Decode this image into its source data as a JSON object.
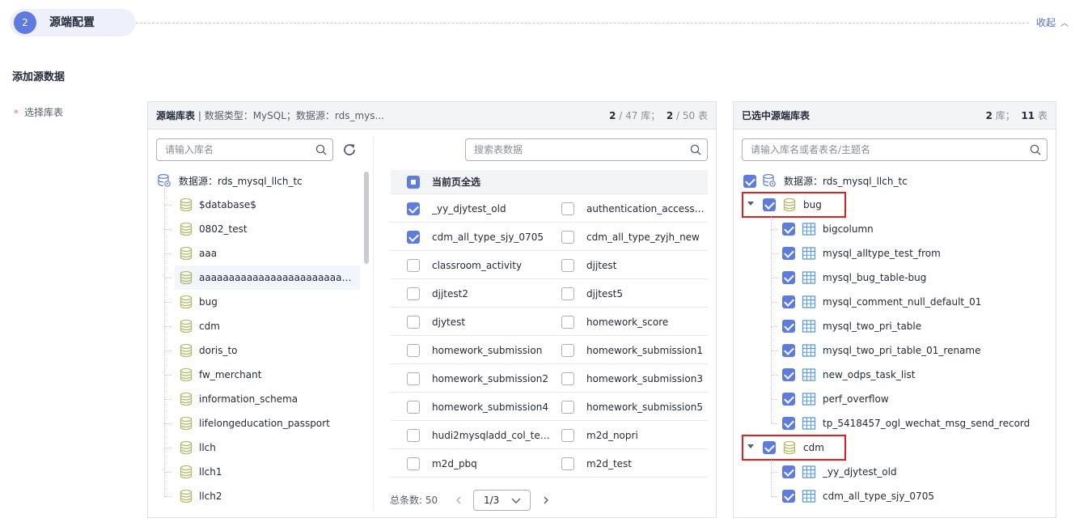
{
  "step": {
    "number": "2",
    "title": "源端配置",
    "collapse_label": "收起"
  },
  "section_title": "添加源数据",
  "field": {
    "required_mark": "*",
    "label": "选择库表"
  },
  "source_panel": {
    "title_bold": "源端库表",
    "title_rest": " | 数据类型：MySQL；数据源：rds_mys...",
    "count": {
      "db_selected": "2",
      "db_total": "/ 47 库；",
      "tbl_selected": "2",
      "tbl_total": "/ 50 表"
    },
    "db_search_placeholder": "请输入库名",
    "table_search_placeholder": "搜索表数据",
    "datasource_label": "数据源：rds_mysql_llch_tc",
    "databases": [
      "$database$",
      "0802_test",
      "aaa",
      "aaaaaaaaaaaaaaaaaaaaaaaaaaaaaaaaaa...",
      "bug",
      "cdm",
      "doris_to",
      "fw_merchant",
      "information_schema",
      "lifelongeducation_passport",
      "llch",
      "llch1",
      "llch2"
    ],
    "select_all_label": "当前页全选",
    "tables": [
      {
        "name": "_yy_djytest_old",
        "checked": true
      },
      {
        "name": "authentication_access_...",
        "checked": false
      },
      {
        "name": "cdm_all_type_sjy_0705",
        "checked": true
      },
      {
        "name": "cdm_all_type_zyjh_new",
        "checked": false
      },
      {
        "name": "classroom_activity",
        "checked": false
      },
      {
        "name": "djjtest",
        "checked": false
      },
      {
        "name": "djjtest2",
        "checked": false
      },
      {
        "name": "djjtest5",
        "checked": false
      },
      {
        "name": "djytest",
        "checked": false
      },
      {
        "name": "homework_score",
        "checked": false
      },
      {
        "name": "homework_submission",
        "checked": false
      },
      {
        "name": "homework_submission1",
        "checked": false
      },
      {
        "name": "homework_submission2",
        "checked": false
      },
      {
        "name": "homework_submission3",
        "checked": false
      },
      {
        "name": "homework_submission4",
        "checked": false
      },
      {
        "name": "homework_submission5",
        "checked": false
      },
      {
        "name": "hudi2mysqladd_col_tes...",
        "checked": false
      },
      {
        "name": "m2d_nopri",
        "checked": false
      },
      {
        "name": "m2d_pbq",
        "checked": false
      },
      {
        "name": "m2d_test",
        "checked": false
      }
    ],
    "pager": {
      "total_label": "总条数:",
      "total": "50",
      "page": "1/3"
    }
  },
  "selected_panel": {
    "title": "已选中源端库表",
    "count": {
      "db": "2",
      "db_unit": "库；",
      "tbl": "11",
      "tbl_unit": "表"
    },
    "search_placeholder": "请输入库名或者表名/主题名",
    "datasource_label": "数据源：rds_mysql_llch_tc",
    "groups": [
      {
        "name": "bug",
        "tables": [
          "bigcolumn",
          "mysql_alltype_test_from",
          "mysql_bug_table-bug",
          "mysql_comment_null_default_01",
          "mysql_two_pri_table",
          "mysql_two_pri_table_01_rename",
          "new_odps_task_list",
          "perf_overflow",
          "tp_5418457_ogl_wechat_msg_send_record"
        ]
      },
      {
        "name": "cdm",
        "tables": [
          "_yy_djytest_old",
          "cdm_all_type_sjy_0705"
        ]
      }
    ]
  },
  "colors": {
    "primary": "#5e7ce0",
    "link": "#526ecc",
    "highlight_box": "#e02020",
    "db_icon": "#b5bb6b",
    "table_icon": "#5e9ce0"
  }
}
